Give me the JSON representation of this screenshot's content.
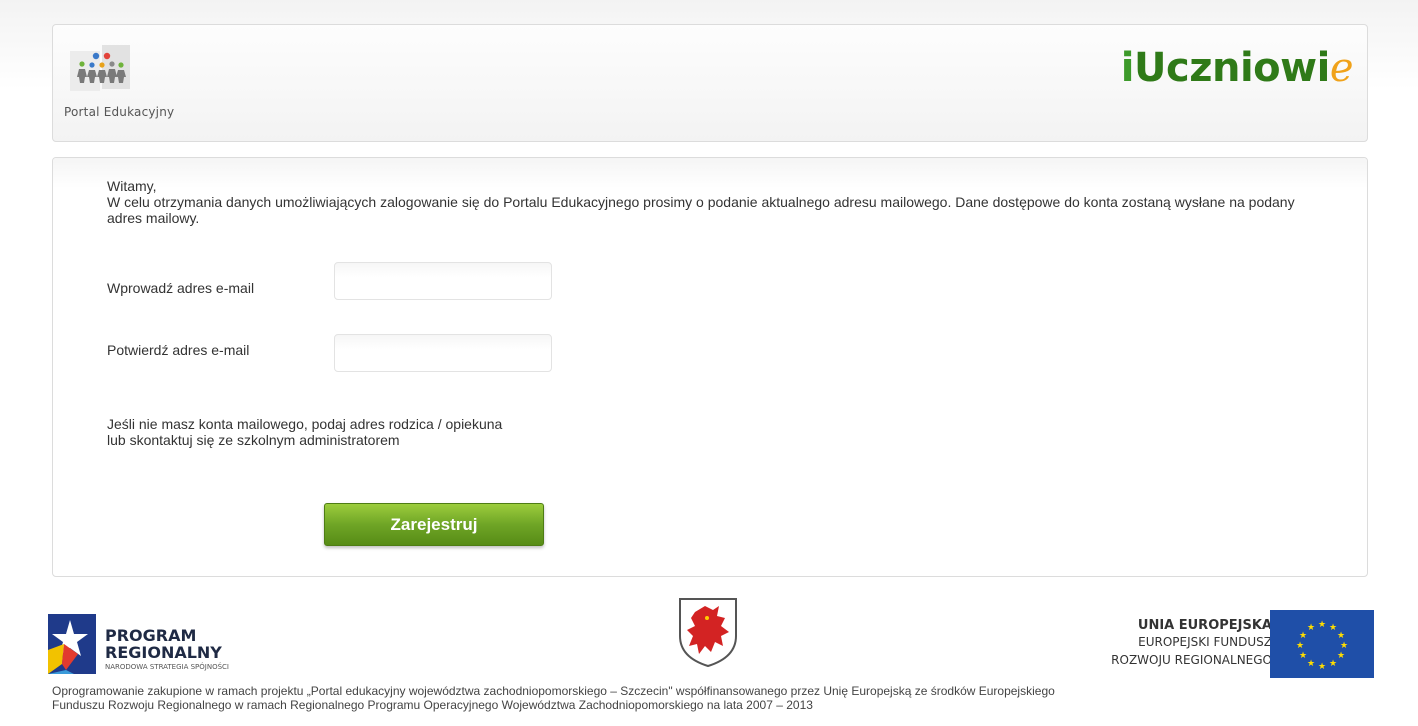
{
  "header": {
    "left_logo_text": "Portal Edukacyjny",
    "right_logo": {
      "prefix": "i",
      "main": "Uczniowi",
      "suffix": "e"
    }
  },
  "form": {
    "greeting": "Witamy,",
    "intro": "W celu otrzymania danych umożliwiających zalogowanie się do Portalu Edukacyjnego prosimy o podanie aktualnego adresu mailowego. Dane dostępowe do konta zostaną wysłane na podany adres mailowy.",
    "email_label": "Wprowadź adres e-mail",
    "email_value": "",
    "confirm_label": "Potwierdź adres e-mail",
    "confirm_value": "",
    "hint_line1": "Jeśli nie masz konta mailowego, podaj adres rodzica / opiekuna",
    "hint_line2": "lub skontaktuj się ze szkolnym administratorem",
    "submit_label": "Zarejestruj"
  },
  "footer": {
    "program_line1": "PROGRAM",
    "program_line2": "REGIONALNY",
    "program_sub": "NARODOWA STRATEGIA SPÓJNOŚCI",
    "ue_title": "UNIA EUROPEJSKA",
    "ue_line1": "EUROPEJSKI FUNDUSZ",
    "ue_line2": "ROZWOJU REGIONALNEGO",
    "disclaimer_line1": "Oprogramowanie zakupione w ramach projektu „Portal edukacyjny województwa zachodniopomorskiego – Szczecin\" współfinansowanego przez Unię Europejską ze środków Europejskiego",
    "disclaimer_line2": "Funduszu Rozwoju Regionalnego w ramach Regionalnego Programu Operacyjnego Województwa Zachodniopomorskiego na lata 2007 – 2013"
  },
  "colors": {
    "brand_green": "#2f7a18",
    "brand_orange": "#f0a21a",
    "button_green": "#6fa526",
    "eu_blue": "#1f4fa8",
    "eu_yellow": "#ffdd00"
  }
}
